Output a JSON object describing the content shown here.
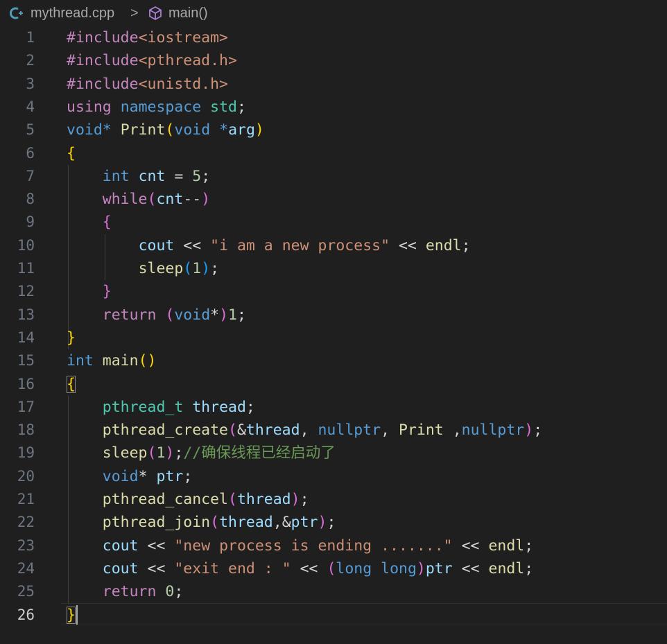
{
  "breadcrumb": {
    "file_icon": "cpp-file-icon",
    "file_name": "mythread.cpp",
    "separator": ">",
    "symbol_icon": "method-cube-icon",
    "symbol_name": "main()"
  },
  "editor": {
    "active_line": 26,
    "line_numbers": [
      "1",
      "2",
      "3",
      "4",
      "5",
      "6",
      "7",
      "8",
      "9",
      "10",
      "11",
      "12",
      "13",
      "14",
      "15",
      "16",
      "17",
      "18",
      "19",
      "20",
      "21",
      "22",
      "23",
      "24",
      "25",
      "26"
    ],
    "lines": [
      "#include<iostream>",
      "#include<pthread.h>",
      "#include<unistd.h>",
      "using namespace std;",
      "void* Print(void *arg)",
      "{",
      "    int cnt = 5;",
      "    while(cnt--)",
      "    {",
      "        cout << \"i am a new process\" << endl;",
      "        sleep(1);",
      "    }",
      "    return (void*)1;",
      "}",
      "int main()",
      "{",
      "    pthread_t thread;",
      "    pthread_create(&thread, nullptr, Print ,nullptr);",
      "    sleep(1);//确保线程已经启动了",
      "    void* ptr;",
      "    pthread_cancel(thread);",
      "    pthread_join(thread,&ptr);",
      "    cout << \"new process is ending .......\" << endl;",
      "    cout << \"exit end : \" << (long long)ptr << endl;",
      "    return 0;",
      "}"
    ]
  },
  "colors": {
    "background": "#1f1f1f",
    "keyword": "#569cd6",
    "control": "#c586c0",
    "string": "#ce9178",
    "function": "#dcdcaa",
    "variable": "#9cdcfe",
    "type": "#4ec9b0",
    "number": "#b5cea8",
    "comment": "#6a9955"
  }
}
